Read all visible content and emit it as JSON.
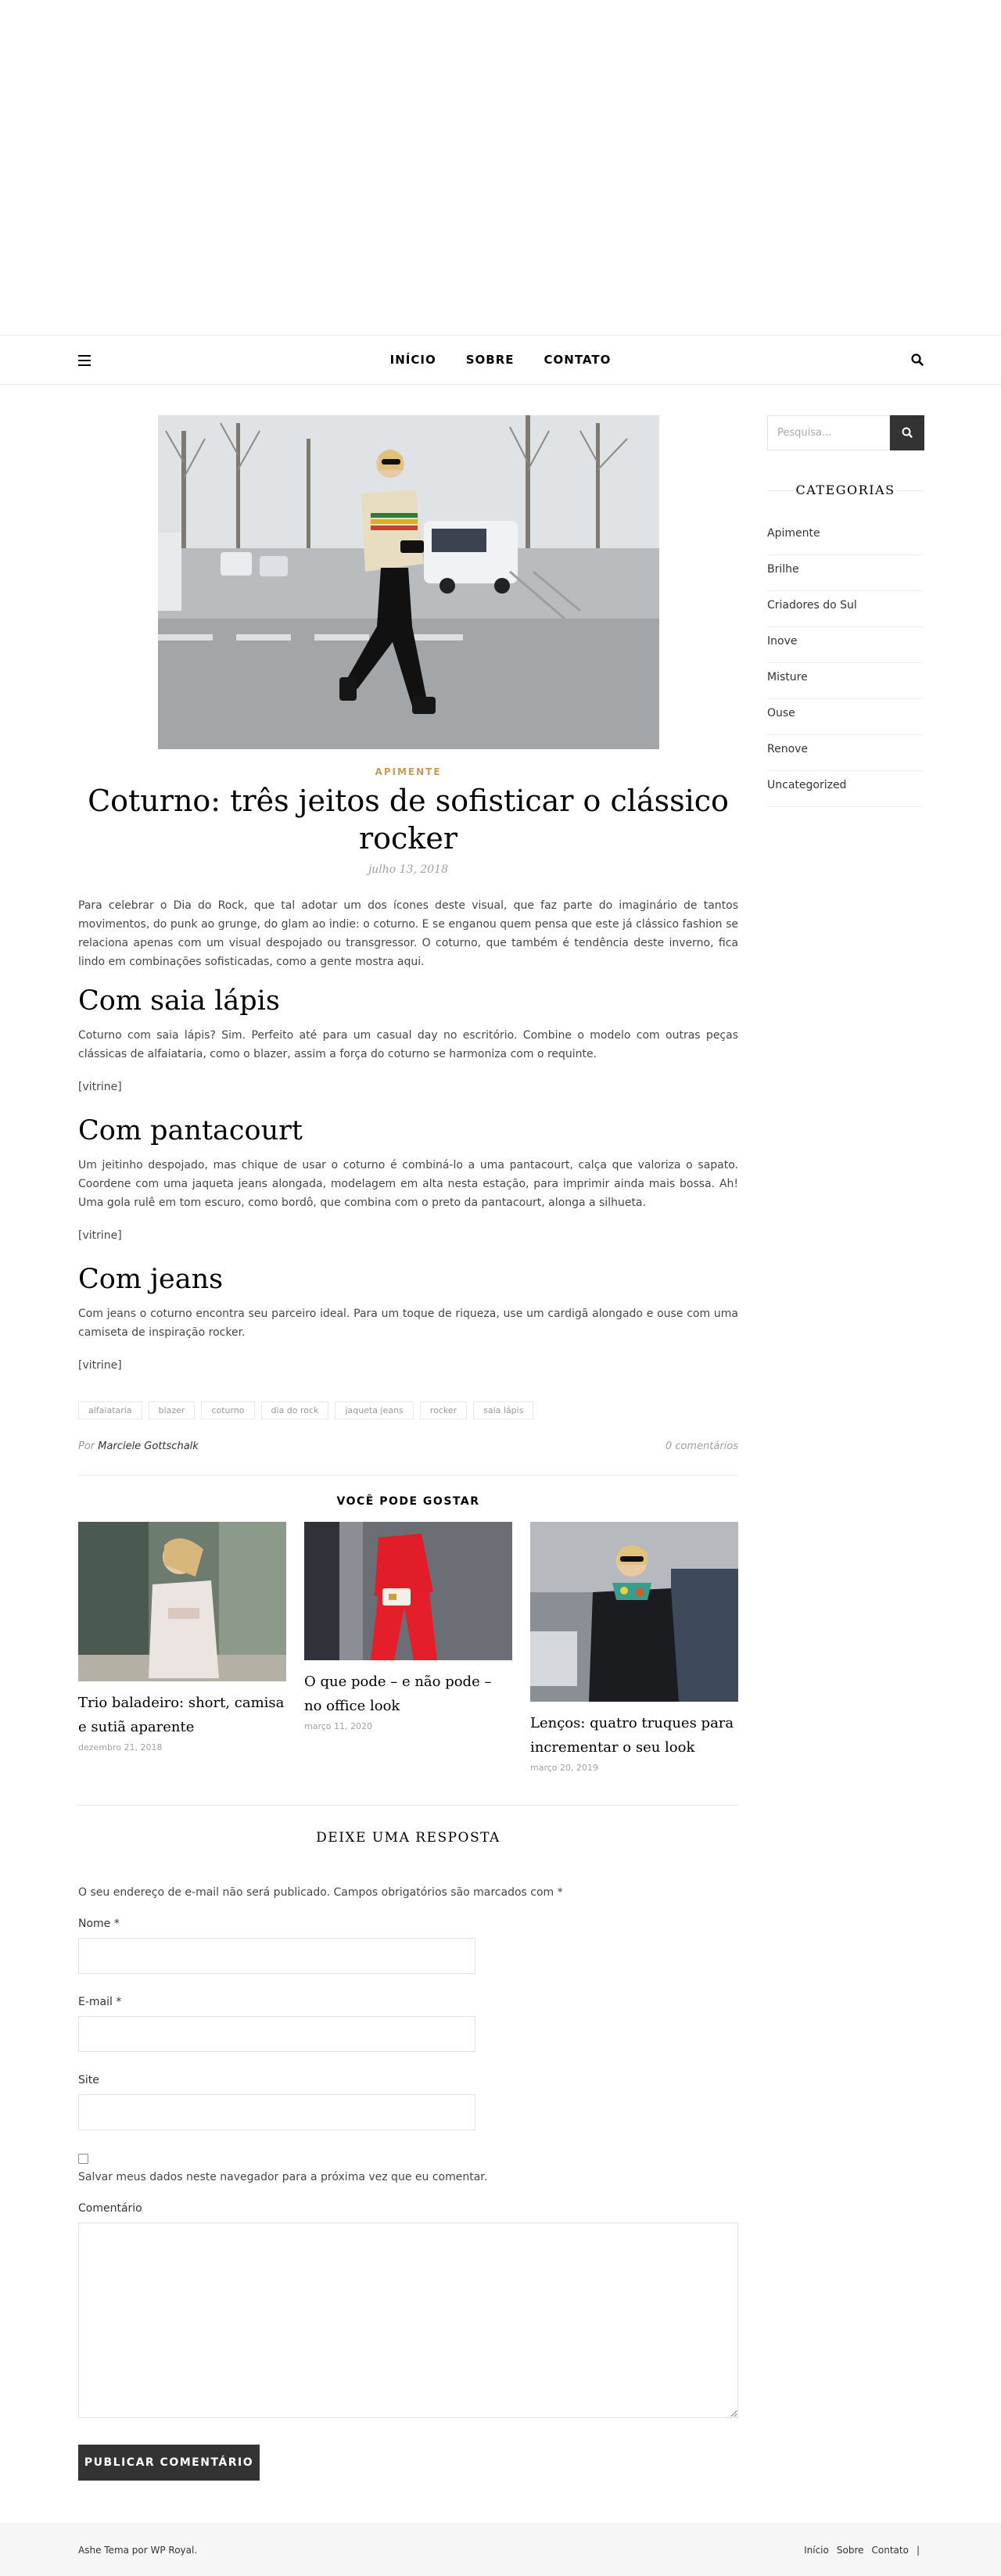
{
  "nav": {
    "menu": [
      "INÍCIO",
      "SOBRE",
      "CONTATO"
    ]
  },
  "post": {
    "category": "APIMENTE",
    "title": "Coturno: três jeitos de sofisticar o clássico rocker",
    "date": "julho 13, 2018",
    "intro": "Para celebrar o Dia do Rock, que tal adotar um dos ícones deste visual, que faz parte do imaginário de tantos movimentos, do punk ao grunge, do glam ao indie: o coturno. E se enganou quem pensa que este já clássico fashion se relaciona apenas com um visual despojado ou transgressor. O coturno, que também é tendência deste inverno, fica lindo em combinações sofisticadas, como a gente mostra aqui.",
    "sections": [
      {
        "heading": "Com saia lápis",
        "text": "Coturno com saia lápis? Sim. Perfeito até para um casual day no escritório. Combine o modelo com outras peças clássicas de alfaiataria, como o blazer, assim a força do coturno se harmoniza com o requinte.",
        "shortcode": "[vitrine]"
      },
      {
        "heading": "Com pantacourt",
        "text": "Um jeitinho despojado, mas chique de usar o coturno é combiná-lo a uma pantacourt, calça que valoriza o sapato. Coordene com uma jaqueta jeans alongada, modelagem em alta nesta estação, para imprimir ainda mais bossa. Ah! Uma gola rulê em tom escuro, como bordô, que combina com o preto da pantacourt, alonga a silhueta.",
        "shortcode": "[vitrine]"
      },
      {
        "heading": "Com jeans",
        "text": "Com jeans o coturno encontra seu parceiro ideal. Para um toque de riqueza, use um cardigã alongado e ouse com uma camiseta de inspiração rocker.",
        "shortcode": "[vitrine]"
      }
    ],
    "tags": [
      "alfaiataria",
      "blazer",
      "coturno",
      "dia do rock",
      "jaqueta jeans",
      "rocker",
      "saia lápis"
    ],
    "by": "Por",
    "author": "Marciele Gottschalk",
    "comments": "0 comentários"
  },
  "related": {
    "heading": "VOCÊ PODE GOSTAR",
    "items": [
      {
        "title": "Trio baladeiro: short, camisa e sutiã aparente",
        "date": "dezembro 21, 2018"
      },
      {
        "title": "O que pode – e não pode – no office look",
        "date": "março 11, 2020"
      },
      {
        "title": "Lenços: quatro truques para incrementar o seu look",
        "date": "março 20, 2019"
      }
    ]
  },
  "reply": {
    "heading": "DEIXE UMA RESPOSTA",
    "note": "O seu endereço de e-mail não será publicado. Campos obrigatórios são marcados com *",
    "name_label": "Nome *",
    "email_label": "E-mail *",
    "site_label": "Site",
    "save_label": "Salvar meus dados neste navegador para a próxima vez que eu comentar.",
    "comment_label": "Comentário",
    "submit": "PUBLICAR COMENTÁRIO"
  },
  "sidebar": {
    "search_placeholder": "Pesquisa...",
    "categories_heading": "CATEGORIAS",
    "categories": [
      "Apimente",
      "Brilhe",
      "Criadores do Sul",
      "Inove",
      "Misture",
      "Ouse",
      "Renove",
      "Uncategorized"
    ]
  },
  "footer": {
    "copyright": "Ashe Tema por WP Royal.",
    "links": [
      "Início",
      "Sobre",
      "Contato"
    ],
    "separator": "|"
  },
  "colors": {
    "accent": "#ca9b52",
    "dark": "#333333"
  }
}
